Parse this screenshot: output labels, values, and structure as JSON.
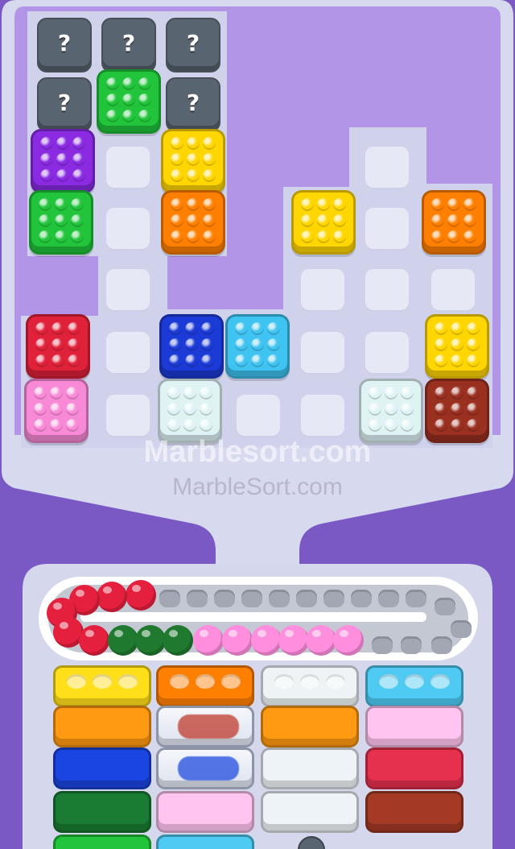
{
  "game": {
    "watermark_primary": "Marblesort.com",
    "watermark_secondary": "MarbleSort.com"
  },
  "colors": {
    "green": "#21c43a",
    "purple": "#8a2be2",
    "yellow": "#ffd600",
    "orange": "#ff7f00",
    "red": "#e0213a",
    "pink": "#f889d6",
    "blue": "#1c3bd6",
    "cyan": "#3fc3f0",
    "white": "#dff3f5",
    "brown": "#9a3020",
    "mystery": "#596471",
    "tray_red": "#e5203e",
    "tray_green": "#1f7a2f",
    "tray_pink": "#ff8fde"
  },
  "mystery_blocks": [
    {
      "label": "?"
    },
    {
      "label": "?"
    },
    {
      "label": "?"
    },
    {
      "label": "?"
    },
    {
      "label": "?"
    }
  ],
  "board_blocks": [
    {
      "id": "green-top",
      "color": "green"
    },
    {
      "id": "purple",
      "color": "purple"
    },
    {
      "id": "yellow-left",
      "color": "yellow"
    },
    {
      "id": "green-left",
      "color": "green"
    },
    {
      "id": "orange-left",
      "color": "orange"
    },
    {
      "id": "yellow-mid",
      "color": "yellow"
    },
    {
      "id": "orange-right",
      "color": "orange"
    },
    {
      "id": "red",
      "color": "red"
    },
    {
      "id": "blue",
      "color": "blue"
    },
    {
      "id": "cyan",
      "color": "cyan"
    },
    {
      "id": "yellow-right",
      "color": "yellow"
    },
    {
      "id": "pink",
      "color": "pink"
    },
    {
      "id": "white-left",
      "color": "white"
    },
    {
      "id": "white-right",
      "color": "white"
    },
    {
      "id": "brown",
      "color": "brown"
    }
  ],
  "conveyor": {
    "marbles": [
      "tray_red",
      "tray_red",
      "tray_red",
      "tray_red",
      "tray_red",
      "tray_red",
      "tray_green",
      "tray_green",
      "tray_green",
      "tray_pink",
      "tray_pink",
      "tray_pink",
      "tray_pink",
      "tray_pink",
      "tray_pink"
    ]
  },
  "boxes": {
    "columns": [
      [
        "yellow-open",
        "orange",
        "blue",
        "green"
      ],
      [
        "orange-open",
        "glass-red",
        "glass-blue",
        "pink"
      ],
      [
        "white-open",
        "orange",
        "white",
        "white"
      ],
      [
        "cyan-open",
        "pink",
        "red",
        "brown"
      ]
    ]
  }
}
